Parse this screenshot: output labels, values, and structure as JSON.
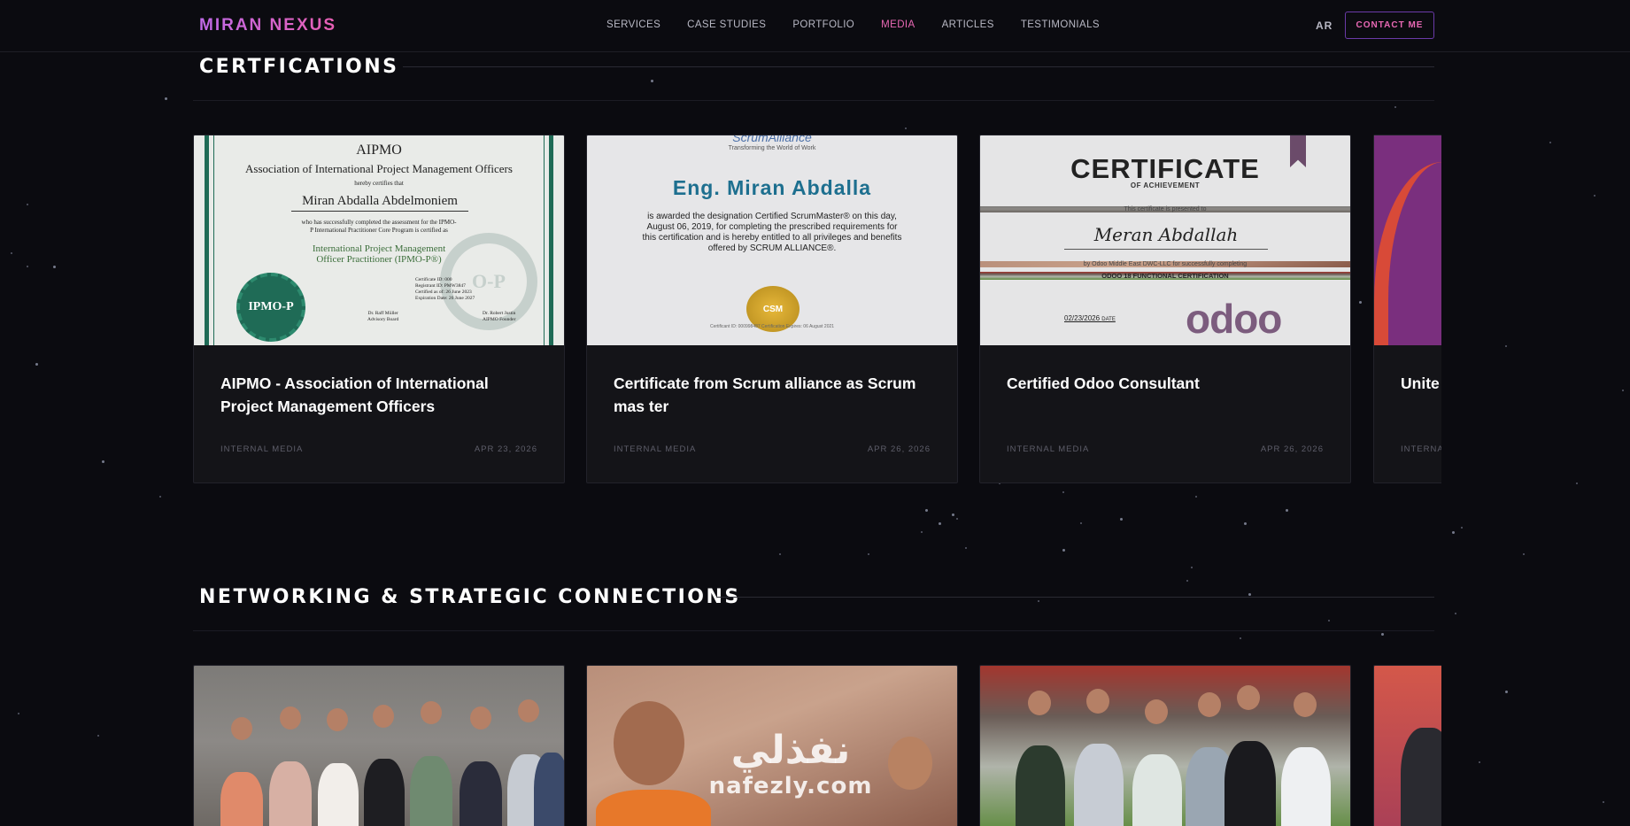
{
  "header": {
    "logo": "MIRAN NEXUS",
    "nav": [
      "SERVICES",
      "CASE STUDIES",
      "PORTFOLIO",
      "MEDIA",
      "ARTICLES",
      "TESTIMONIALS"
    ],
    "active_nav": "MEDIA",
    "lang_toggle": "AR",
    "contact_label": "CONTACT ME"
  },
  "certifications": {
    "title": "CERTFICATIONS",
    "cards": [
      {
        "title": "AIPMO - Association of International Project Management Officers",
        "source": "INTERNAL MEDIA",
        "date": "APR 23, 2026"
      },
      {
        "title": "Certificate from Scrum alliance as Scrum mas ter",
        "source": "INTERNAL MEDIA",
        "date": "APR 26, 2026"
      },
      {
        "title": "Certified Odoo Consultant",
        "source": "INTERNAL MEDIA",
        "date": "APR 26, 2026"
      },
      {
        "title": "Unite",
        "source": "INTERNA",
        "date": ""
      }
    ],
    "cert_images": {
      "aipmo": {
        "brand": "AIPMO",
        "org": "Association of International Project Management Officers",
        "certifies": "hereby certifies that",
        "name": "Miran Abdalla Abdelmoniem",
        "body": "who has successfully completed the assessment for the IPMO-P International Practitioner Core Program is certified as",
        "designation": "International Project Management Officer Practitioner (IPMO-P®)",
        "seal": "IPMO-P",
        "details": "Certificate ID: 000\nRegistrant ID: PMW3847\nCertified as of: 26 June 2023\nExpiration Date: 26 June 2027",
        "sig_left": "Dr. Raff Müller\nAdvisory Board",
        "sig_right": "Dr. Robert Justin\nAIPMO Founder"
      },
      "scrum": {
        "brand": "ScrumAlliance",
        "tagline": "Transforming the World of Work",
        "name": "Eng. Miran Abdalla",
        "body": "is awarded the designation Certified ScrumMaster® on this day, August 06, 2019, for completing the prescribed requirements for this certification and is hereby entitled to all privileges and benefits offered by SCRUM ALLIANCE®.",
        "badge": "CSM",
        "footer": "Certificant ID: 000998487 Certification Expires: 06 August 2021"
      },
      "odoo": {
        "heading": "CERTIFICATE",
        "subheading": "OF ACHIEVEMENT",
        "presented": "This certificate is presented to",
        "name": "Meran Abdallah",
        "issuer": "by Odoo Middle East DWC-LLC for successfully completing",
        "course": "ODOO 18 FUNCTIONAL CERTIFICATION",
        "date": "02/23/2026",
        "date_label": "DATE",
        "logo": "odoo"
      }
    }
  },
  "networking": {
    "title": "NETWORKING & STRATEGIC CONNECTIONS",
    "watermark_ar": "نفذلي",
    "watermark_en": "nafezly.com"
  },
  "colors": {
    "background": "#0b0b10",
    "accent_pink": "#e868b4",
    "accent_purple": "#6a3aa8",
    "card_bg": "#141418"
  }
}
